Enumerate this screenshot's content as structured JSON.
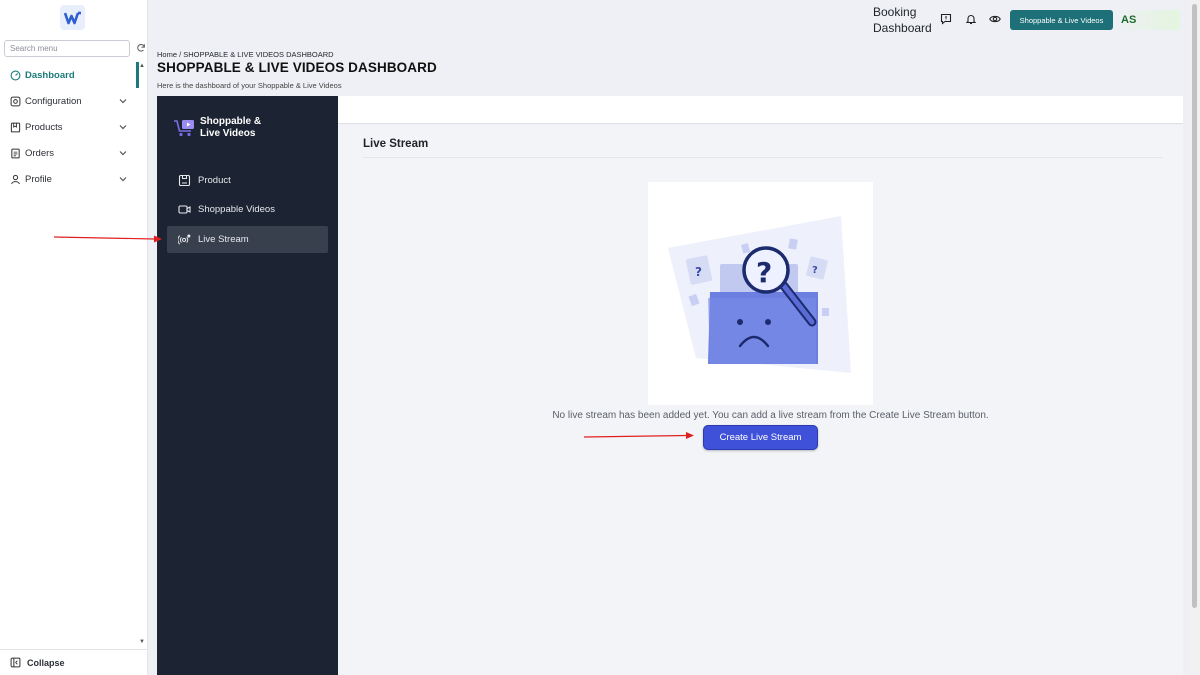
{
  "sidebar": {
    "search_placeholder": "Search menu",
    "items": [
      {
        "label": "Dashboard",
        "icon": "gauge-icon"
      },
      {
        "label": "Configuration",
        "icon": "settings-icon"
      },
      {
        "label": "Products",
        "icon": "bookmark-icon"
      },
      {
        "label": "Orders",
        "icon": "document-icon"
      },
      {
        "label": "Profile",
        "icon": "user-icon"
      }
    ],
    "collapse_label": "Collapse"
  },
  "topbar": {
    "booking_label": "Booking Dashboard",
    "app_button_label": "Shoppable & Live Videos",
    "avatar_initials": "AS"
  },
  "page": {
    "breadcrumb": "Home / SHOPPABLE & LIVE VIDEOS DASHBOARD",
    "title": "SHOPPABLE & LIVE VIDEOS DASHBOARD",
    "subtitle": "Here is the dashboard of your Shoppable & Live Videos"
  },
  "inner_sidebar": {
    "brand_name": "Shoppable & Live Videos",
    "items": [
      {
        "label": "Product",
        "icon": "product-icon"
      },
      {
        "label": "Shoppable Videos",
        "icon": "video-camera-icon"
      },
      {
        "label": "Live Stream",
        "icon": "live-stream-icon",
        "active": true
      }
    ]
  },
  "main": {
    "section_title": "Live Stream",
    "empty_message": "No live stream has been added yet. You can add a live stream from the Create Live Stream button.",
    "create_button_label": "Create Live Stream"
  },
  "colors": {
    "accent_teal": "#1d6f78",
    "dark_sidebar": "#1c2433",
    "primary_button": "#3f51d8",
    "annotation_arrow": "#e02020"
  }
}
